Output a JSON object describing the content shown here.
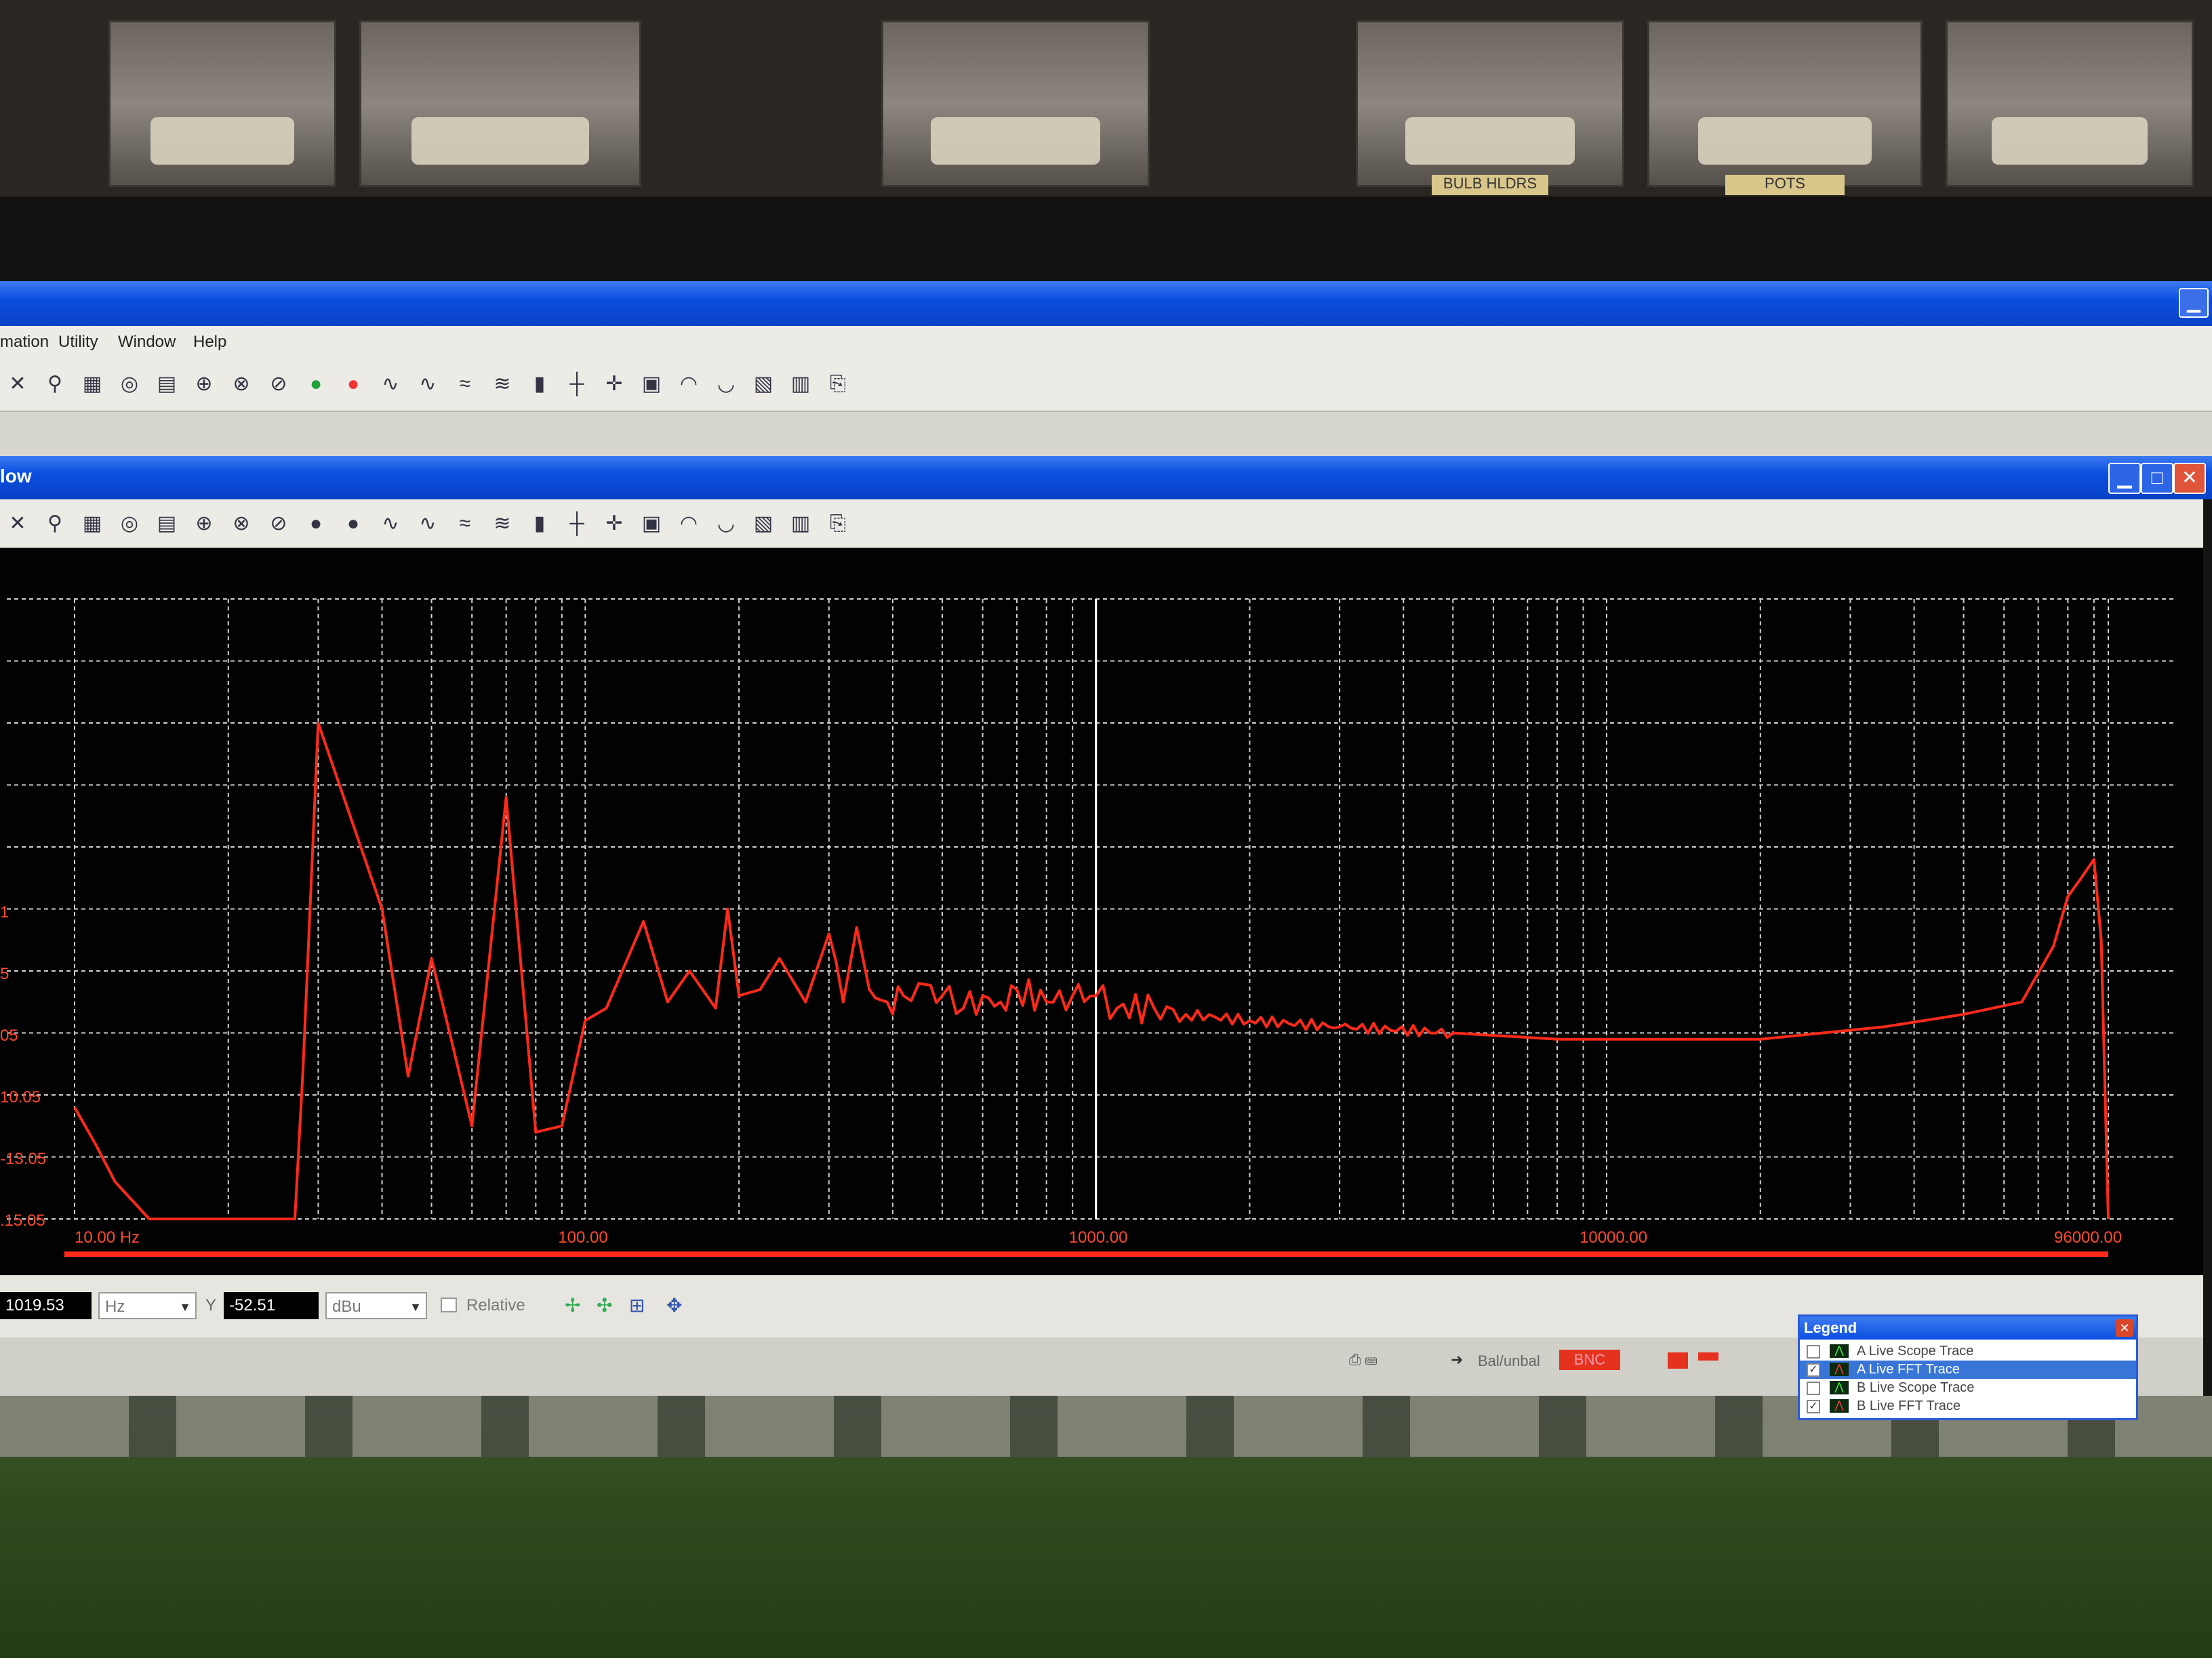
{
  "photo": {
    "bin_labels": [
      "BULB HLDRS",
      "POTS"
    ]
  },
  "menu": [
    "mation",
    "Utility",
    "Window",
    "Help"
  ],
  "app_toolbar_icons": [
    "sweep-icon",
    "phase-icon",
    "meter-icon",
    "generator-icon",
    "graph-icon",
    "ab-icon",
    "ab2-icon",
    "ab3-icon",
    "run-green-icon",
    "stop-red-icon",
    "signal-icon",
    "signal2-icon",
    "wave-icon",
    "wave2-icon",
    "bars-icon",
    "split-icon",
    "marker-icon",
    "chart-icon",
    "fft-icon",
    "fft2-icon",
    "window-icon",
    "report-icon",
    "export-icon"
  ],
  "child_window": {
    "title": "low",
    "buttons": {
      "minimize": "▁",
      "maximize": "□",
      "close": "✕"
    }
  },
  "graph_toolbar_icons": [
    "copy-icon",
    "graph-view-icon",
    "table-view-icon",
    "settings-icon",
    "grid-icon",
    "zoom-in-icon",
    "zoom-out-icon",
    "autoscale-icon",
    "cursor1-icon",
    "cursor2-icon",
    "cursor3-icon",
    "cursor4-icon",
    "peak-icon",
    "peak2-icon",
    "fit-icon",
    "scale-icon",
    "up-icon",
    "down-icon",
    "marker-add-icon",
    "marker-move-icon",
    "smooth-icon",
    "avg-icon",
    "delta-icon"
  ],
  "chart_data": {
    "type": "line",
    "x_scale": "log",
    "xlim": [
      10,
      96000
    ],
    "x_tick_labels": [
      "10.00 Hz",
      "100.00",
      "1000.00",
      "10000.00",
      "96000.00"
    ],
    "y_tick_labels": [
      ".15.05",
      "-13.05",
      "10.05",
      "05",
      "5",
      "1"
    ],
    "grid": true,
    "line_color": "#ff2a1a",
    "cursor": {
      "x": 1000
    },
    "series": [
      {
        "x": [
          10,
          11,
          12,
          14,
          27,
          28,
          30,
          40,
          45,
          50,
          55,
          60,
          70,
          80,
          90,
          100,
          110,
          130,
          145,
          160,
          180,
          190,
          200,
          220,
          240,
          270,
          300,
          320,
          340,
          360,
          390,
          420,
          450,
          500,
          550,
          600,
          650,
          700,
          800,
          900,
          1000,
          1100,
          1300,
          1500,
          2000,
          3000,
          5000,
          8000,
          12000,
          20000,
          35000,
          50000,
          65000,
          75000,
          80000,
          85000,
          90000,
          93000,
          96000
        ],
        "y": [
          -112,
          -118,
          -124,
          -130,
          -130,
          -106,
          -50,
          -80,
          -107,
          -88,
          -102,
          -115,
          -62,
          -116,
          -115,
          -98,
          -96,
          -82,
          -95,
          -90,
          -96,
          -80,
          -94,
          -93,
          -88,
          -95,
          -84,
          -95,
          -83,
          -93,
          -95,
          -94,
          -92,
          -94,
          -96,
          -94,
          -95,
          -93,
          -95,
          -94,
          -94,
          -96,
          -96,
          -97,
          -98,
          -99,
          -100,
          -101,
          -101,
          -101,
          -99,
          -97,
          -95,
          -86,
          -78,
          -75,
          -72,
          -85,
          -130
        ]
      }
    ]
  },
  "status": {
    "x_value": "1019.53",
    "x_unit": "Hz",
    "y_label": "Y",
    "y_value": "-52.51",
    "y_unit": "dBu",
    "relative_label": "Relative"
  },
  "bottom": {
    "bal_label": "Bal/unbal",
    "bnc_label": "BNC"
  },
  "legend": {
    "title": "Legend",
    "items": [
      {
        "label": "A  Live Scope Trace",
        "checked": "",
        "kind": "scope"
      },
      {
        "label": "A  Live FFT Trace",
        "checked": "✓",
        "kind": "fft"
      },
      {
        "label": "B  Live Scope Trace",
        "checked": "",
        "kind": "scope"
      },
      {
        "label": "B  Live FFT Trace",
        "checked": "✓",
        "kind": "fft"
      }
    ]
  }
}
